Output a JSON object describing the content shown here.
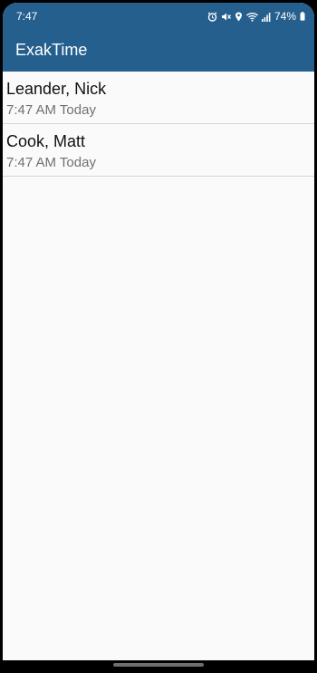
{
  "status_bar": {
    "time": "7:47",
    "battery": "74%",
    "icons": [
      "alarm-icon",
      "mute-icon",
      "location-icon",
      "wifi-icon",
      "signal-icon",
      "battery-icon"
    ]
  },
  "app_bar": {
    "title": "ExakTime",
    "color": "#255f8e"
  },
  "list": {
    "items": [
      {
        "name": "Leander, Nick",
        "time": "7:47 AM Today"
      },
      {
        "name": "Cook, Matt",
        "time": "7:47 AM Today"
      }
    ]
  }
}
